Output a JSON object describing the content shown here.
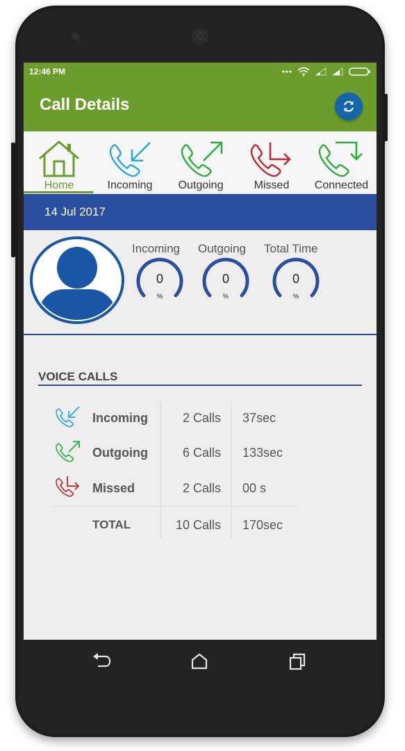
{
  "status": {
    "time": "12:46 PM",
    "icons": [
      "more-dots-icon",
      "wifi-icon",
      "signal-icon",
      "signal-icon",
      "battery-icon"
    ]
  },
  "appbar": {
    "title": "Call Details",
    "action_icon": "refresh-icon",
    "color": "#6c9d2c"
  },
  "tabs": [
    {
      "label": "Home",
      "icon": "home-icon",
      "selected": true,
      "color": "#6c9d2c"
    },
    {
      "label": "Incoming",
      "icon": "incoming-call-icon",
      "color": "#29a9d8"
    },
    {
      "label": "Outgoing",
      "icon": "outgoing-call-icon",
      "color": "#2cae3c"
    },
    {
      "label": "Missed",
      "icon": "missed-call-icon",
      "color": "#c0272d"
    },
    {
      "label": "Connected",
      "icon": "connected-call-icon",
      "color": "#2cae3c"
    }
  ],
  "date": "14 Jul 2017",
  "gauges": [
    {
      "label": "Incoming",
      "value": "0",
      "unit": "%"
    },
    {
      "label": "Outgoing",
      "value": "0",
      "unit": "%"
    },
    {
      "label": "Total Time",
      "value": "0",
      "unit": "%"
    }
  ],
  "voice_calls": {
    "title": "VOICE CALLS",
    "rows": [
      {
        "type": "Incoming",
        "calls": "2 Calls",
        "duration": "37sec",
        "icon": "incoming-call-icon"
      },
      {
        "type": "Outgoing",
        "calls": "6 Calls",
        "duration": "133sec",
        "icon": "outgoing-call-icon"
      },
      {
        "type": "Missed",
        "calls": "2 Calls",
        "duration": "00 s",
        "icon": "missed-call-icon"
      },
      {
        "type": "TOTAL",
        "calls": "10 Calls",
        "duration": "170sec"
      }
    ]
  },
  "navbar": {
    "icons": [
      "back-icon",
      "home-nav-icon",
      "recents-icon"
    ]
  },
  "colors": {
    "accent_blue": "#2a4fa0",
    "refresh_blue": "#1565a8"
  }
}
